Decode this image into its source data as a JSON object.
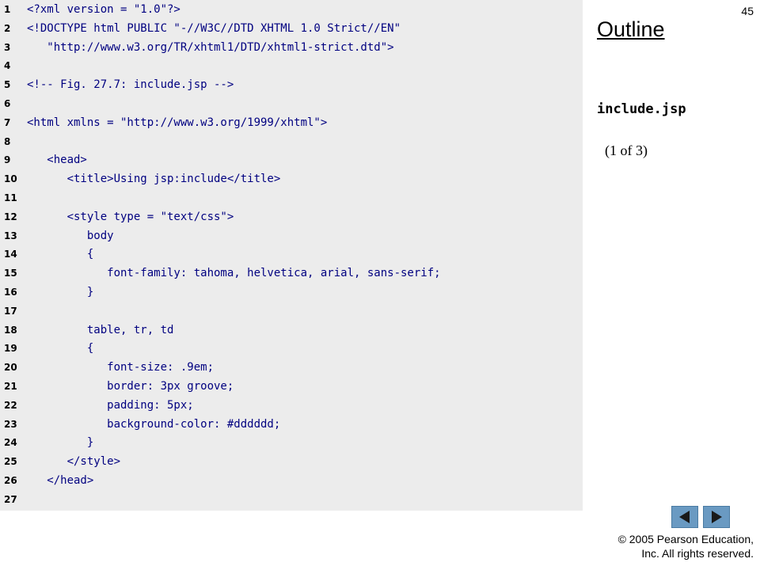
{
  "slide": {
    "number": "45",
    "outline_label": "Outline",
    "file_name": "include.jsp",
    "page_info": "(1 of 3)",
    "copyright_line1": "© 2005 Pearson Education,",
    "copyright_line2": "Inc.  All rights reserved."
  },
  "navigation": {
    "prev_icon": "triangle-left-icon",
    "next_icon": "triangle-right-icon",
    "button_color": "#6a9ac2"
  },
  "code": {
    "lines": [
      {
        "n": "1",
        "text": "<?xml version = \"1.0\"?>"
      },
      {
        "n": "2",
        "text": "<!DOCTYPE html PUBLIC \"-//W3C//DTD XHTML 1.0 Strict//EN\""
      },
      {
        "n": "3",
        "text": "   \"http://www.w3.org/TR/xhtml1/DTD/xhtml1-strict.dtd\">"
      },
      {
        "n": "4",
        "text": ""
      },
      {
        "n": "5",
        "text": "<!-- Fig. 27.7: include.jsp -->"
      },
      {
        "n": "6",
        "text": ""
      },
      {
        "n": "7",
        "text": "<html xmlns = \"http://www.w3.org/1999/xhtml\">"
      },
      {
        "n": "8",
        "text": ""
      },
      {
        "n": "9",
        "text": "   <head>"
      },
      {
        "n": "10",
        "text": "      <title>Using jsp:include</title>"
      },
      {
        "n": "11",
        "text": ""
      },
      {
        "n": "12",
        "text": "      <style type = \"text/css\">"
      },
      {
        "n": "13",
        "text": "         body"
      },
      {
        "n": "14",
        "text": "         {"
      },
      {
        "n": "15",
        "text": "            font-family: tahoma, helvetica, arial, sans-serif;"
      },
      {
        "n": "16",
        "text": "         }"
      },
      {
        "n": "17",
        "text": ""
      },
      {
        "n": "18",
        "text": "         table, tr, td"
      },
      {
        "n": "19",
        "text": "         {"
      },
      {
        "n": "20",
        "text": "            font-size: .9em;"
      },
      {
        "n": "21",
        "text": "            border: 3px groove;"
      },
      {
        "n": "22",
        "text": "            padding: 5px;"
      },
      {
        "n": "23",
        "text": "            background-color: #dddddd;"
      },
      {
        "n": "24",
        "text": "         }"
      },
      {
        "n": "25",
        "text": "      </style>"
      },
      {
        "n": "26",
        "text": "   </head>"
      },
      {
        "n": "27",
        "text": ""
      }
    ]
  }
}
